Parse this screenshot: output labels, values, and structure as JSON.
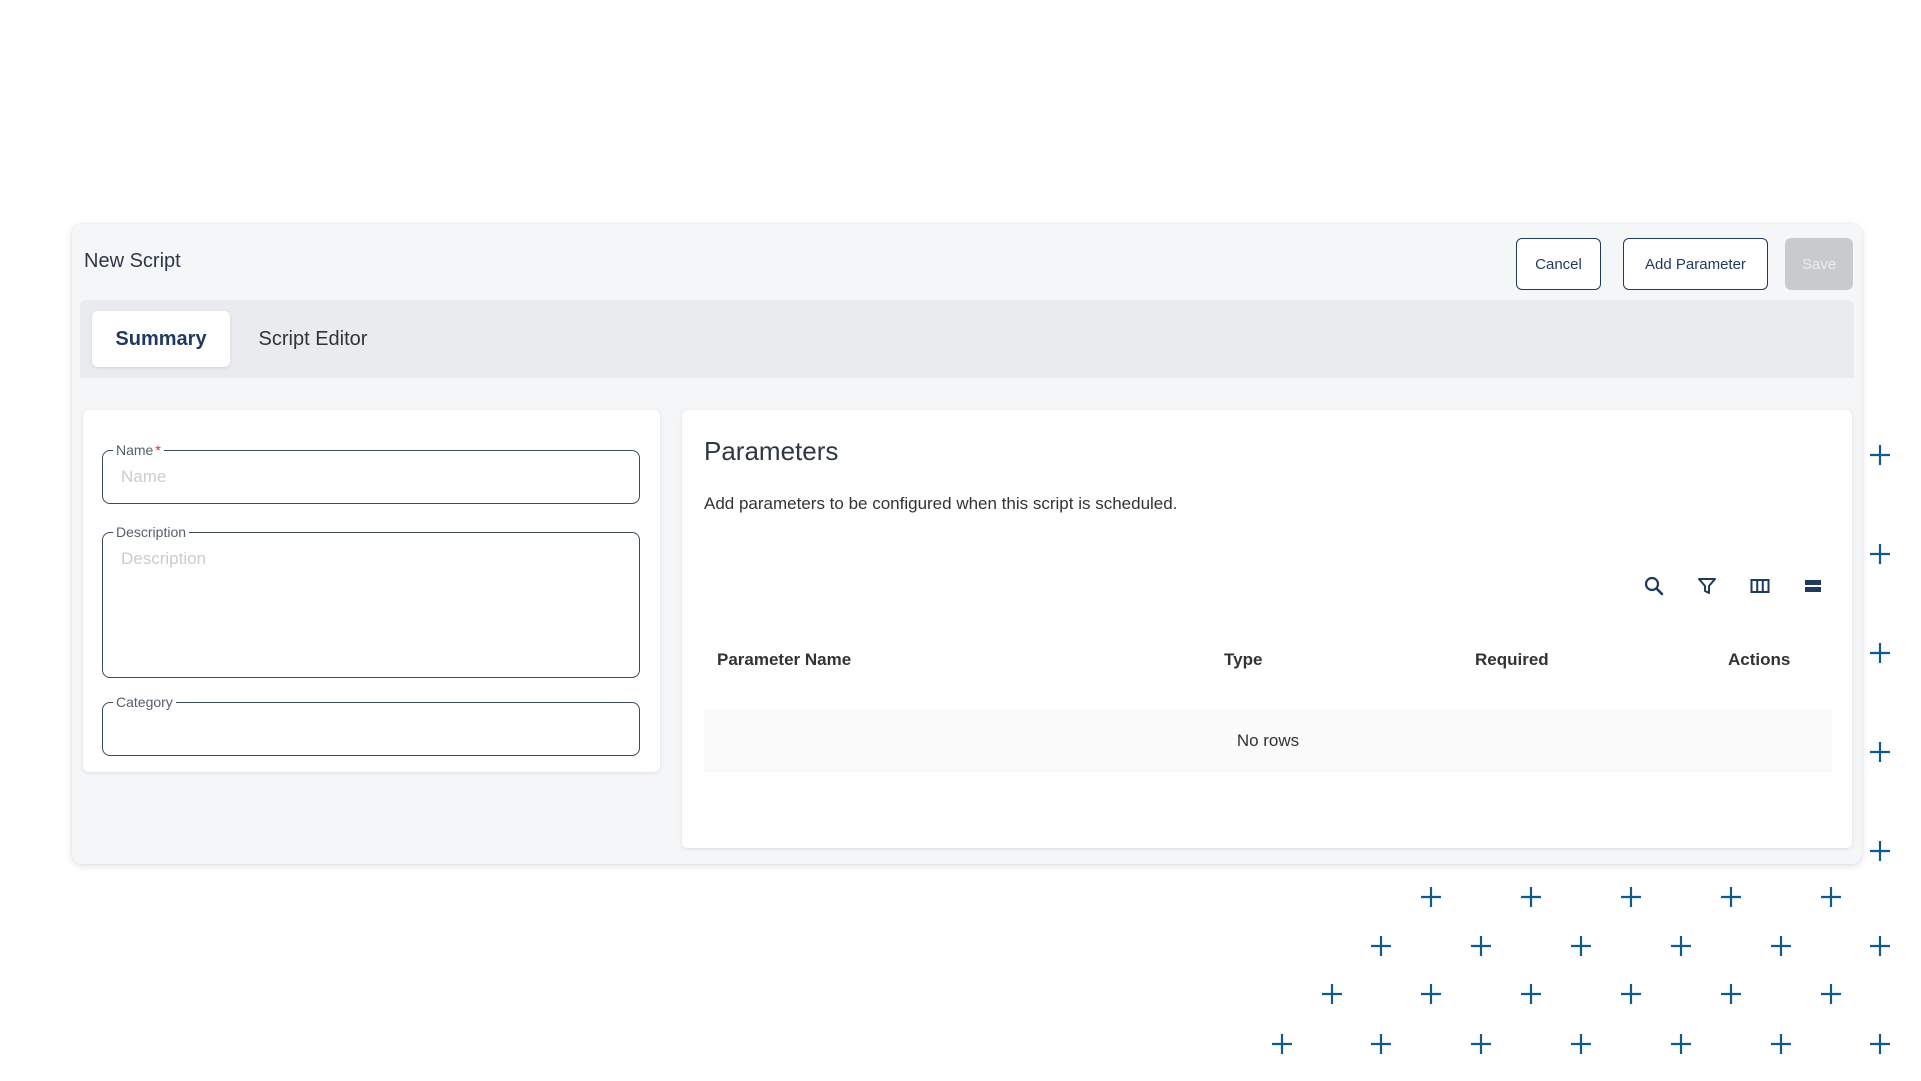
{
  "window": {
    "title": "New Script"
  },
  "actions": {
    "cancel": "Cancel",
    "add_parameter": "Add Parameter",
    "save": "Save"
  },
  "tabs": [
    {
      "label": "Summary",
      "active": true
    },
    {
      "label": "Script Editor",
      "active": false
    }
  ],
  "form": {
    "name": {
      "label": "Name",
      "required_mark": "*",
      "value": "",
      "placeholder": "Name"
    },
    "description": {
      "label": "Description",
      "value": "",
      "placeholder": "Description"
    },
    "category": {
      "label": "Category",
      "value": ""
    }
  },
  "parameters": {
    "title": "Parameters",
    "description": "Add parameters to be configured when this script is scheduled.",
    "toolbar": [
      "search-icon",
      "filter-icon",
      "columns-icon",
      "density-icon"
    ],
    "columns": [
      "Parameter Name",
      "Type",
      "Required",
      "Actions"
    ],
    "rows": [],
    "empty_text": "No rows"
  },
  "colors": {
    "accent": "#1f3a5f",
    "decoration": "#0e5a8a",
    "disabled": "#c9cacc",
    "required": "#d32f2f"
  }
}
